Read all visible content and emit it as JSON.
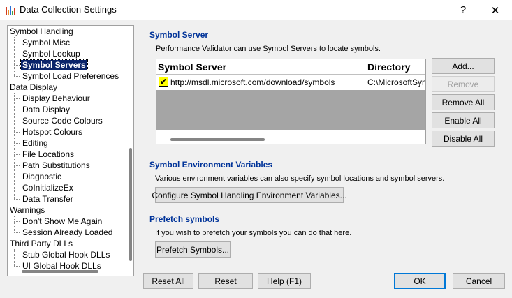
{
  "window": {
    "title": "Data Collection Settings",
    "help_glyph": "?",
    "close_glyph": "✕"
  },
  "tree": {
    "items": [
      {
        "label": "Symbol Handling"
      },
      {
        "label": "Symbol Misc"
      },
      {
        "label": "Symbol Lookup"
      },
      {
        "label": "Symbol Servers",
        "selected": true
      },
      {
        "label": "Symbol Load Preferences"
      },
      {
        "label": "Data Display"
      },
      {
        "label": "Display Behaviour"
      },
      {
        "label": "Data Display"
      },
      {
        "label": "Source Code Colours"
      },
      {
        "label": "Hotspot Colours"
      },
      {
        "label": "Editing"
      },
      {
        "label": "File Locations"
      },
      {
        "label": "Path Substitutions"
      },
      {
        "label": "Diagnostic"
      },
      {
        "label": "CoInitializeEx"
      },
      {
        "label": "Data Transfer"
      },
      {
        "label": "Warnings"
      },
      {
        "label": "Don't Show Me Again"
      },
      {
        "label": "Session Already Loaded"
      },
      {
        "label": "Third Party DLLs"
      },
      {
        "label": "Stub Global Hook DLLs"
      },
      {
        "label": "UI Global Hook DLLs"
      }
    ]
  },
  "symbol_server": {
    "title": "Symbol Server",
    "description": "Performance Validator can use Symbol Servers to locate symbols.",
    "columns": [
      "Symbol Server",
      "Directory"
    ],
    "rows": [
      {
        "checked": true,
        "check_glyph": "✔",
        "server": "http://msdl.microsoft.com/download/symbols",
        "directory": "C:\\MicrosoftSym"
      }
    ],
    "buttons": {
      "add": "Add...",
      "remove": "Remove",
      "remove_all": "Remove All",
      "enable_all": "Enable All",
      "disable_all": "Disable All"
    }
  },
  "env_vars": {
    "title": "Symbol Environment Variables",
    "description": "Various environment variables can also specify symbol locations and symbol servers.",
    "button": "Configure Symbol Handling Environment Variables..."
  },
  "prefetch": {
    "title": "Prefetch symbols",
    "description": "If you wish to prefetch your symbols you can do that here.",
    "button": "Prefetch Symbols..."
  },
  "footer": {
    "reset_all": "Reset All",
    "reset": "Reset",
    "help": "Help (F1)",
    "ok": "OK",
    "cancel": "Cancel"
  },
  "colors": {
    "section_title": "#003399",
    "selection_bg": "#0a246a",
    "checkbox_bg": "#ffff00",
    "grid_empty": "#a5a5a5"
  }
}
